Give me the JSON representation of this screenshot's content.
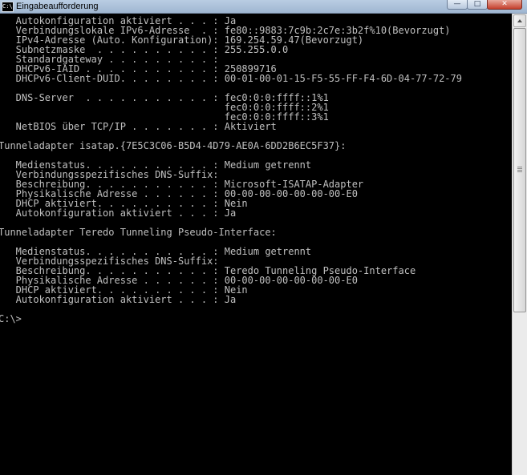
{
  "window": {
    "title": "Eingabeaufforderung",
    "icon": "cmd-icon",
    "icon_text": "C:\\",
    "buttons": {
      "minimize": "—",
      "maximize": "□",
      "close": "✕"
    }
  },
  "console": {
    "text_color": "#c0c0c0",
    "background": "#000000",
    "lines": [
      "   Autokonfiguration aktiviert . . . : Ja",
      "   Verbindungslokale IPv6-Adresse  . : fe80::9883:7c9b:2c7e:3b2f%10(Bevorzugt)",
      "   IPv4-Adresse (Auto. Konfiguration): 169.254.59.47(Bevorzugt)",
      "   Subnetzmaske  . . . . . . . . . . : 255.255.0.0",
      "   Standardgateway . . . . . . . . . :",
      "   DHCPv6-IAID . . . . . . . . . . . : 250899716",
      "   DHCPv6-Client-DUID. . . . . . . . : 00-01-00-01-15-F5-55-FF-F4-6D-04-77-72-79",
      "",
      "   DNS-Server  . . . . . . . . . . . : fec0:0:0:ffff::1%1",
      "                                       fec0:0:0:ffff::2%1",
      "                                       fec0:0:0:ffff::3%1",
      "   NetBIOS über TCP/IP . . . . . . . : Aktiviert",
      "",
      "Tunneladapter isatap.{7E5C3C06-B5D4-4D79-AE0A-6DD2B6EC5F37}:",
      "",
      "   Medienstatus. . . . . . . . . . . : Medium getrennt",
      "   Verbindungsspezifisches DNS-Suffix:",
      "   Beschreibung. . . . . . . . . . . : Microsoft-ISATAP-Adapter",
      "   Physikalische Adresse . . . . . . : 00-00-00-00-00-00-00-E0",
      "   DHCP aktiviert. . . . . . . . . . : Nein",
      "   Autokonfiguration aktiviert . . . : Ja",
      "",
      "Tunneladapter Teredo Tunneling Pseudo-Interface:",
      "",
      "   Medienstatus. . . . . . . . . . . : Medium getrennt",
      "   Verbindungsspezifisches DNS-Suffix:",
      "   Beschreibung. . . . . . . . . . . : Teredo Tunneling Pseudo-Interface",
      "   Physikalische Adresse . . . . . . : 00-00-00-00-00-00-00-E0",
      "   DHCP aktiviert. . . . . . . . . . : Nein",
      "   Autokonfiguration aktiviert . . . : Ja",
      "",
      "C:\\>"
    ]
  }
}
